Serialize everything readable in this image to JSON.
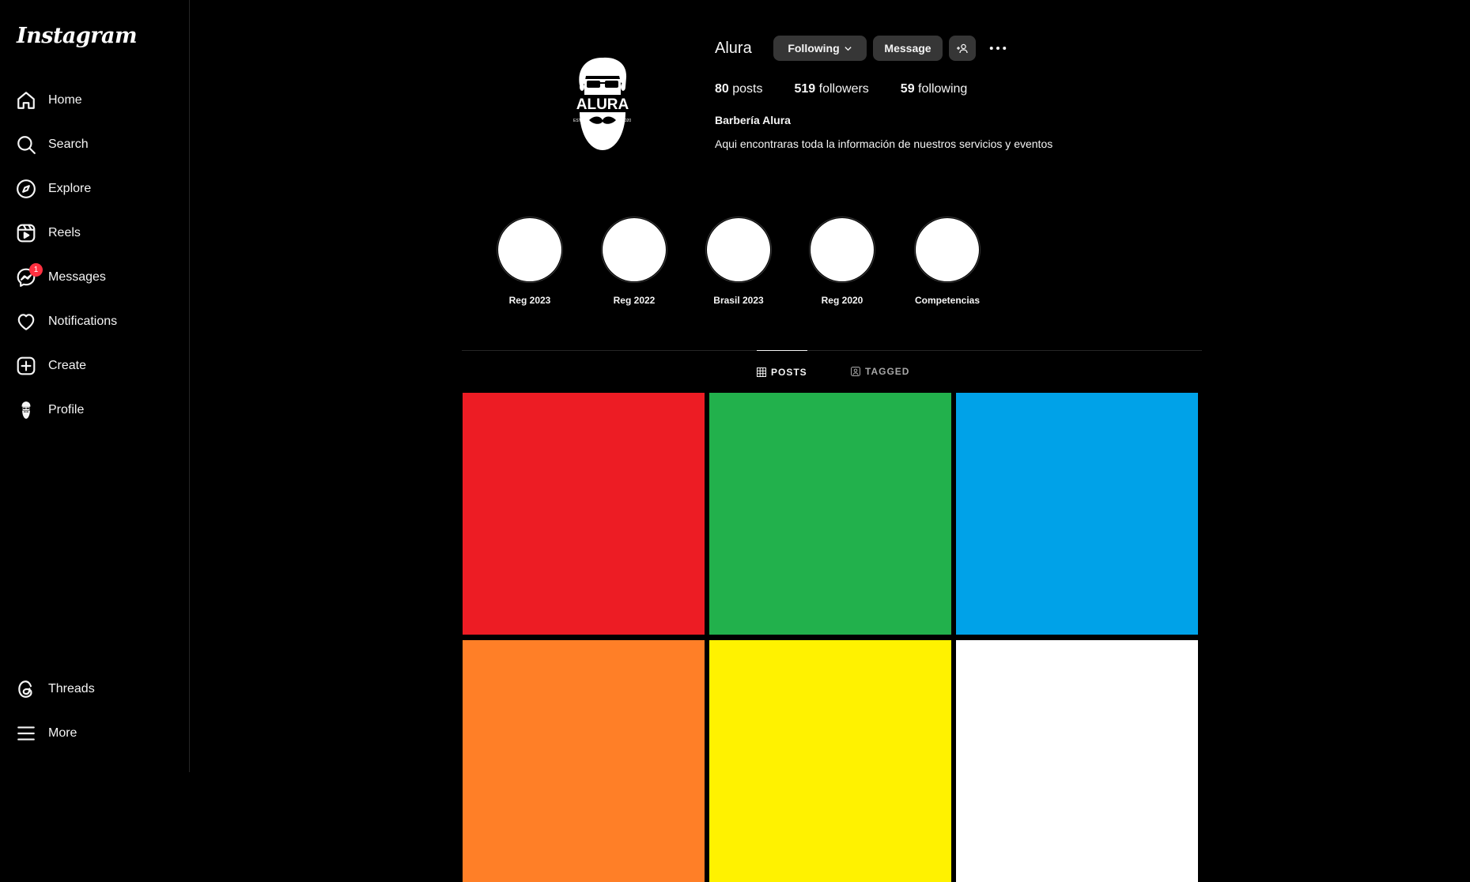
{
  "app": {
    "logo": "Instagram"
  },
  "sidebar": {
    "items": [
      {
        "label": "Home",
        "icon": "home-icon"
      },
      {
        "label": "Search",
        "icon": "search-icon"
      },
      {
        "label": "Explore",
        "icon": "compass-icon"
      },
      {
        "label": "Reels",
        "icon": "reels-icon"
      },
      {
        "label": "Messages",
        "icon": "messenger-icon",
        "badge": "1"
      },
      {
        "label": "Notifications",
        "icon": "heart-icon"
      },
      {
        "label": "Create",
        "icon": "plus-square-icon"
      },
      {
        "label": "Profile",
        "icon": "profile-avatar-icon"
      }
    ],
    "bottom_items": [
      {
        "label": "Threads",
        "icon": "threads-icon"
      },
      {
        "label": "More",
        "icon": "menu-icon"
      }
    ]
  },
  "profile": {
    "username": "Alura",
    "avatar_text": "ALURA",
    "avatar_est": "ESTD",
    "avatar_year": "2020",
    "following_label": "Following",
    "message_label": "Message",
    "stats": {
      "posts_count": "80",
      "posts_label": "posts",
      "followers_count": "519",
      "followers_label": "followers",
      "following_count": "59",
      "following_label": "following"
    },
    "bio_name": "Barbería Alura",
    "bio_text": "Aqui encontraras toda la información de nuestros servicios y eventos"
  },
  "highlights": [
    {
      "label": "Reg 2023"
    },
    {
      "label": "Reg 2022"
    },
    {
      "label": "Brasil 2023"
    },
    {
      "label": "Reg 2020"
    },
    {
      "label": "Competencias"
    }
  ],
  "tabs": {
    "posts": "POSTS",
    "tagged": "TAGGED"
  },
  "posts": [
    {
      "color": "#ed1c24"
    },
    {
      "color": "#22b14c"
    },
    {
      "color": "#00a2e8"
    },
    {
      "color": "#ff7f27"
    },
    {
      "color": "#fff200"
    },
    {
      "color": "#ffffff"
    }
  ]
}
